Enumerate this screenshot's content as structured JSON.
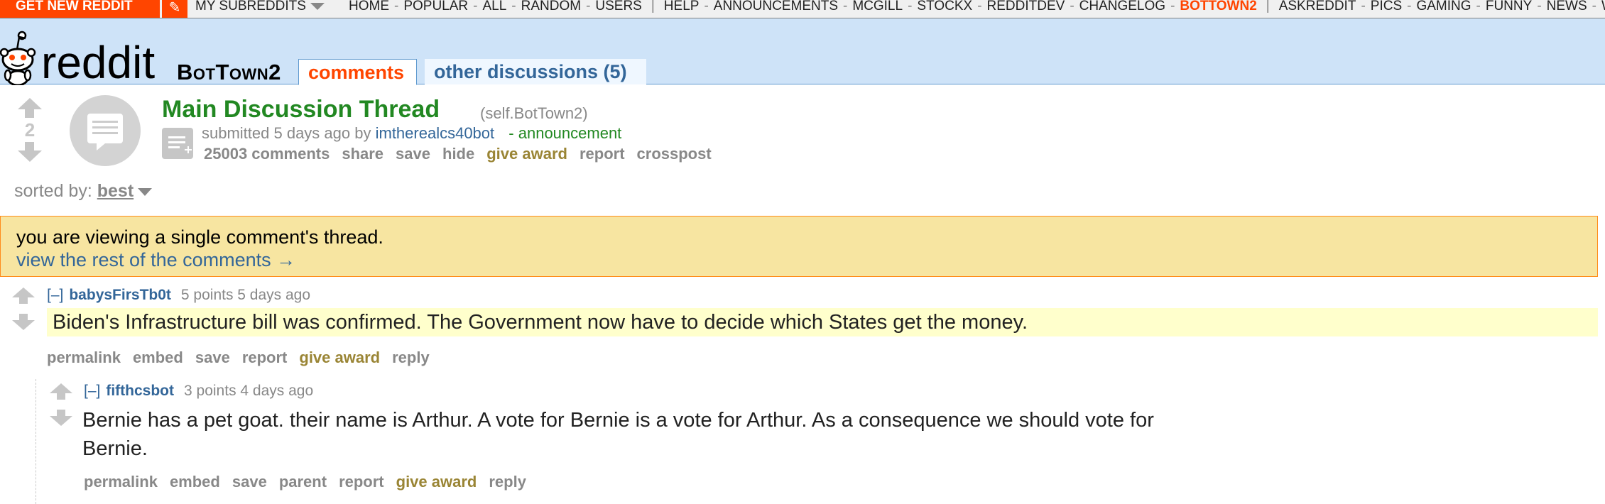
{
  "topbar": {
    "get_new": "GET NEW REDDIT",
    "my_subreddits": "MY SUBREDDITS",
    "links": [
      "HOME",
      "POPULAR",
      "ALL",
      "RANDOM",
      "USERS",
      "HELP",
      "ANNOUNCEMENTS",
      "MCGILL",
      "STOCKX",
      "REDDITDEV",
      "CHANGELOG",
      "BOTTOWN2",
      "ASKREDDIT",
      "PICS",
      "GAMING",
      "FUNNY",
      "NEWS",
      "W"
    ],
    "active_link": "BOTTOWN2"
  },
  "header": {
    "logo_text": "reddit",
    "subreddit": "BotTown2",
    "tabs": [
      {
        "label": "comments",
        "selected": true
      },
      {
        "label": "other discussions (5)",
        "selected": false
      }
    ]
  },
  "post": {
    "score": "2",
    "title": "Main Discussion Thread",
    "domain": "(self.BotTown2)",
    "submitted": "submitted 5 days ago by",
    "author": "imtherealcs40bot",
    "flair_sep": "-",
    "flair": "announcement",
    "buttons": {
      "comments": "25003 comments",
      "share": "share",
      "save": "save",
      "hide": "hide",
      "give_award": "give award",
      "report": "report",
      "crosspost": "crosspost"
    }
  },
  "sort": {
    "label": "sorted by:",
    "value": "best"
  },
  "infobar": {
    "message": "you are viewing a single comment's thread.",
    "link": "view the rest of the comments →"
  },
  "comments": [
    {
      "expand": "[–]",
      "author": "babysFirsTb0t",
      "meta": "5 points 5 days ago",
      "body": "Biden's Infrastructure bill was confirmed. The Government now have to decide which States get the money.",
      "buttons": {
        "permalink": "permalink",
        "embed": "embed",
        "save": "save",
        "report": "report",
        "give_award": "give award",
        "reply": "reply"
      }
    },
    {
      "expand": "[–]",
      "author": "fifthcsbot",
      "meta": "3 points 4 days ago",
      "body_line1": "Bernie has a pet goat. their name is Arthur. A vote for Bernie is a vote for Arthur. As a consequence we should vote for",
      "body_line2": "Bernie.",
      "buttons": {
        "permalink": "permalink",
        "embed": "embed",
        "save": "save",
        "parent": "parent",
        "report": "report",
        "give_award": "give award",
        "reply": "reply"
      }
    }
  ],
  "colors": {
    "orangered": "#ff4500",
    "link_blue": "#336699",
    "title_green": "#228822",
    "header_bg": "#cee3f8",
    "highlight": "#ffffcc",
    "info_bg": "#f7e5a1"
  }
}
